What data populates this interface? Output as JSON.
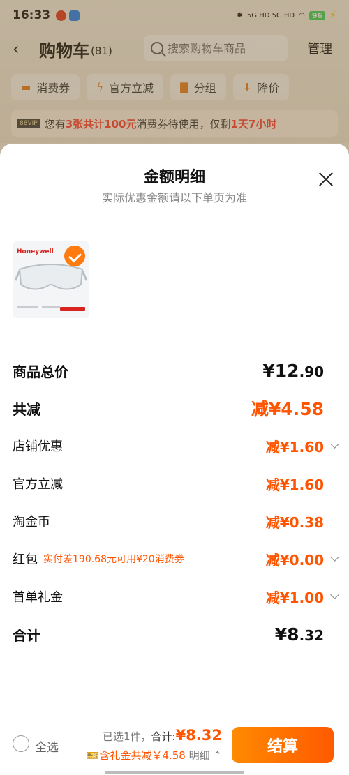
{
  "status": {
    "time": "16:33",
    "network": "5G HD 5G HD",
    "battery": "96"
  },
  "header": {
    "title": "购物车",
    "count": "(81)",
    "search_placeholder": "搜索购物车商品",
    "manage": "管理"
  },
  "chips": [
    "消费券",
    "官方立减",
    "分组",
    "降价"
  ],
  "notice": {
    "badge": "88VIP",
    "p1": "您有",
    "hl1": "3张共计100元",
    "p2": "消费券待使用，仅剩",
    "hl2": "1天7小时"
  },
  "sheet": {
    "title": "金额明细",
    "subtitle": "实际优惠金额请以下单页为准",
    "product_brand": "Honeywell",
    "rows": [
      {
        "label": "商品总价",
        "value": "¥12",
        "value_small": ".90"
      },
      {
        "label": "共减",
        "value": "减¥4.58"
      },
      {
        "label": "店铺优惠",
        "value": "减¥1.60"
      },
      {
        "label": "官方立减",
        "value": "减¥1.60"
      },
      {
        "label": "淘金币",
        "value": "减¥0.38"
      },
      {
        "label": "红包",
        "note": "实付差190.68元可用¥20消费券",
        "value": "减¥0.00"
      },
      {
        "label": "首单礼金",
        "value": "减¥1.00"
      },
      {
        "label": "合计",
        "value": "¥8",
        "value_small": ".32"
      }
    ]
  },
  "bottom": {
    "select_all": "全选",
    "selected": "已选1件，",
    "total_label": "合计:",
    "total": "¥8.32",
    "gift": "含礼金共减￥4.58",
    "detail": "明细",
    "pay": "结算"
  },
  "colors": {
    "accent": "#ff5500",
    "pay_gradient_start": "#ff8a00"
  }
}
